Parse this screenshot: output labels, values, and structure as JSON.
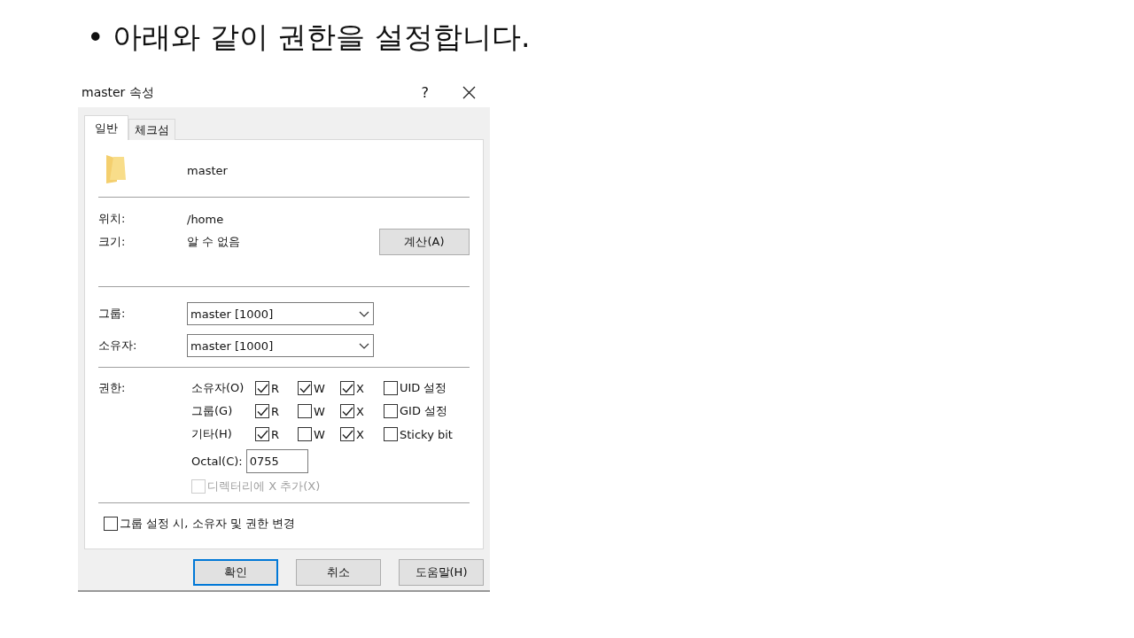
{
  "slide": {
    "bullet": "•",
    "heading": "아래와 같이 권한을 설정합니다."
  },
  "dialog": {
    "title": "master 속성",
    "help": "?",
    "tabs": [
      {
        "label": "일반",
        "selected": true
      },
      {
        "label": "체크섬",
        "selected": false
      }
    ],
    "name": "master",
    "info": [
      {
        "label": "위치:",
        "value": "/home"
      },
      {
        "label": "크기:",
        "value": "알 수 없음"
      }
    ],
    "calc_button": "계산(A)",
    "combos": [
      {
        "label": "그룹:",
        "value": "master [1000]"
      },
      {
        "label": "소유자:",
        "value": "master [1000]"
      }
    ],
    "permissions_label": "권한:",
    "permission_rows": [
      {
        "label": "소유자(O)",
        "bits": [
          {
            "label": "R",
            "checked": true
          },
          {
            "label": "W",
            "checked": true
          },
          {
            "label": "X",
            "checked": true
          },
          {
            "label": "UID 설정",
            "checked": false
          }
        ]
      },
      {
        "label": "그룹(G)",
        "bits": [
          {
            "label": "R",
            "checked": true
          },
          {
            "label": "W",
            "checked": false
          },
          {
            "label": "X",
            "checked": true
          },
          {
            "label": "GID 설정",
            "checked": false
          }
        ]
      },
      {
        "label": "기타(H)",
        "bits": [
          {
            "label": "R",
            "checked": true
          },
          {
            "label": "W",
            "checked": false
          },
          {
            "label": "X",
            "checked": true
          },
          {
            "label": "Sticky bit",
            "checked": false
          }
        ]
      }
    ],
    "octal": {
      "label": "Octal(C):",
      "value": "0755"
    },
    "dir_option": {
      "label": "디렉터리에 X 추가(X)",
      "checked": false,
      "disabled": true
    },
    "recursive_option": {
      "label": "그룹 설정 시, 소유자 및 권한 변경",
      "checked": false,
      "disabled": false
    },
    "buttons": [
      {
        "label": "확인",
        "default": true
      },
      {
        "label": "취소",
        "default": false
      },
      {
        "label": "도움말(H)",
        "default": false
      }
    ]
  }
}
